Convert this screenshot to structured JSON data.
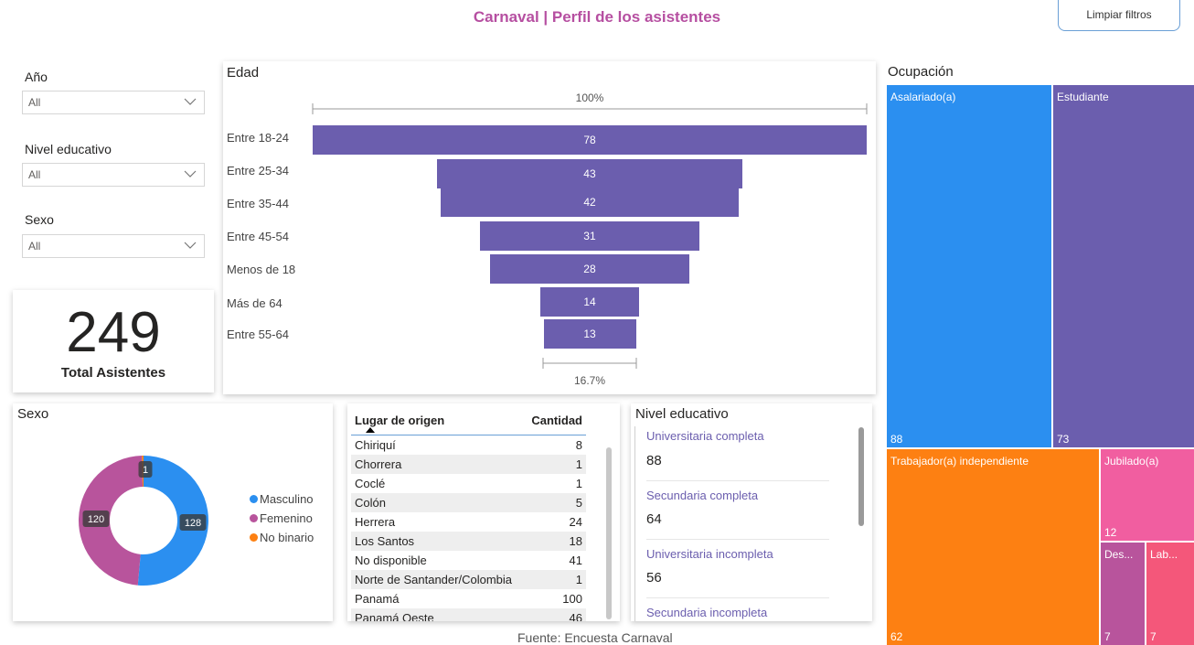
{
  "header": {
    "title": "Carnaval | Perfil de los asistentes",
    "clear_button": "Limpiar filtros"
  },
  "slicers": [
    {
      "label": "Año",
      "value": "All"
    },
    {
      "label": "Nivel educativo",
      "value": "All"
    },
    {
      "label": "Sexo",
      "value": "All"
    }
  ],
  "kpi": {
    "value": "249",
    "label": "Total Asistentes"
  },
  "edad": {
    "title": "Edad",
    "top_pct": "100%",
    "bottom_pct": "16.7%",
    "chart_data": {
      "type": "bar",
      "categories": [
        "Entre 18-24",
        "Entre 25-34",
        "Entre 35-44",
        "Entre 45-54",
        "Menos de 18",
        "Más de 64",
        "Entre 55-64"
      ],
      "values": [
        78,
        43,
        42,
        31,
        28,
        14,
        13
      ],
      "title": "Edad",
      "xlabel": "",
      "ylabel": ""
    }
  },
  "ocupacion": {
    "title": "Ocupación",
    "cells": [
      {
        "label": "Asalariado(a)",
        "value": 88,
        "color": "#2b8ff0"
      },
      {
        "label": "Estudiante",
        "value": 73,
        "color": "#6b5eae"
      },
      {
        "label": "Trabajador(a) independiente",
        "value": 62,
        "color": "#fd8012"
      },
      {
        "label": "Jubilado(a)",
        "value": 12,
        "color": "#f15ea0"
      },
      {
        "label": "Des...",
        "value": 7,
        "color": "#b8549c"
      },
      {
        "label": "Lab...",
        "value": 7,
        "color": "#f4577a"
      }
    ]
  },
  "sexo": {
    "title": "Sexo",
    "chart_data": {
      "type": "pie",
      "categories": [
        "Masculino",
        "Femenino",
        "No binario"
      ],
      "values": [
        128,
        120,
        1
      ],
      "colors": [
        "#2b8ff0",
        "#b8549c",
        "#fd8012"
      ]
    },
    "legend": [
      "Masculino",
      "Femenino",
      "No binario"
    ]
  },
  "lugar": {
    "headers": [
      "Lugar de origen",
      "Cantidad"
    ],
    "rows": [
      [
        "Chiriquí",
        "8"
      ],
      [
        "Chorrera",
        "1"
      ],
      [
        "Coclé",
        "1"
      ],
      [
        "Colón",
        "5"
      ],
      [
        "Herrera",
        "24"
      ],
      [
        "Los Santos",
        "18"
      ],
      [
        "No disponible",
        "41"
      ],
      [
        "Norte de Santander/Colombia",
        "1"
      ],
      [
        "Panamá",
        "100"
      ],
      [
        "Panamá Oeste",
        "46"
      ]
    ]
  },
  "nivel": {
    "title": "Nivel educativo",
    "items": [
      {
        "label": "Universitaria completa",
        "value": "88"
      },
      {
        "label": "Secundaria completa",
        "value": "64"
      },
      {
        "label": "Universitaria incompleta",
        "value": "56"
      },
      {
        "label": "Secundaria incompleta",
        "value": ""
      }
    ]
  },
  "footer": {
    "source": "Fuente: Encuesta Carnaval"
  }
}
